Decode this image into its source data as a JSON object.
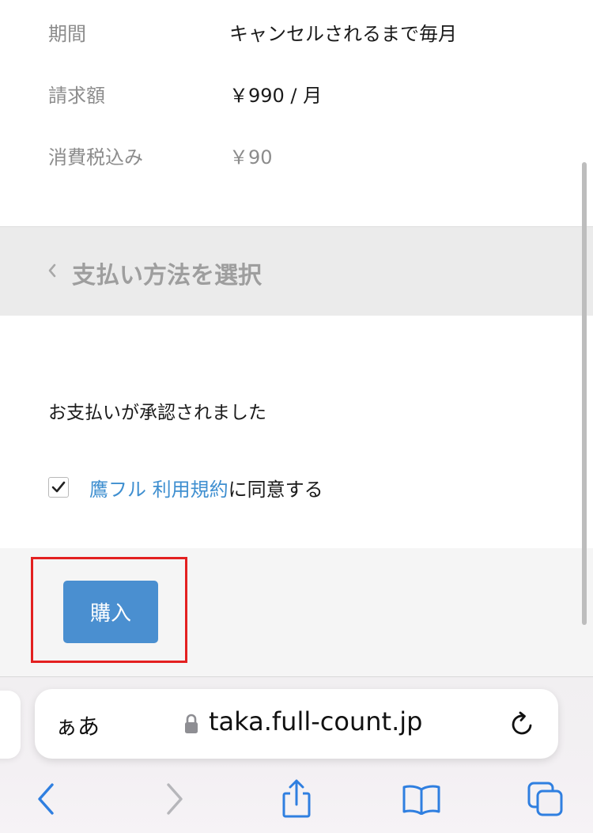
{
  "summary": {
    "rows": [
      {
        "label": "期間",
        "value": "キャンセルされるまで毎月"
      },
      {
        "label": "請求額",
        "value": "￥990 / 月"
      },
      {
        "label": "消費税込み",
        "value": "￥90"
      }
    ]
  },
  "section": {
    "title": "支払い方法を選択",
    "icon": "chevron-left-icon"
  },
  "payment": {
    "status_text": "お支払いが承認されました"
  },
  "terms": {
    "checked": true,
    "link_text": "鷹フル 利用規約",
    "suffix_text": "に同意する"
  },
  "purchase": {
    "button_label": "購入"
  },
  "browser": {
    "aa_label": "ぁあ",
    "url": "taka.full-count.jp",
    "icons": [
      "lock-icon",
      "reload-icon",
      "back-arrow-icon",
      "forward-arrow-icon",
      "share-icon",
      "bookmarks-icon",
      "tabs-icon"
    ]
  },
  "colors": {
    "accent": "#3f8fd0",
    "button": "#4a8fd0",
    "highlight": "#e32020",
    "ios_blue": "#2f7fe0"
  }
}
